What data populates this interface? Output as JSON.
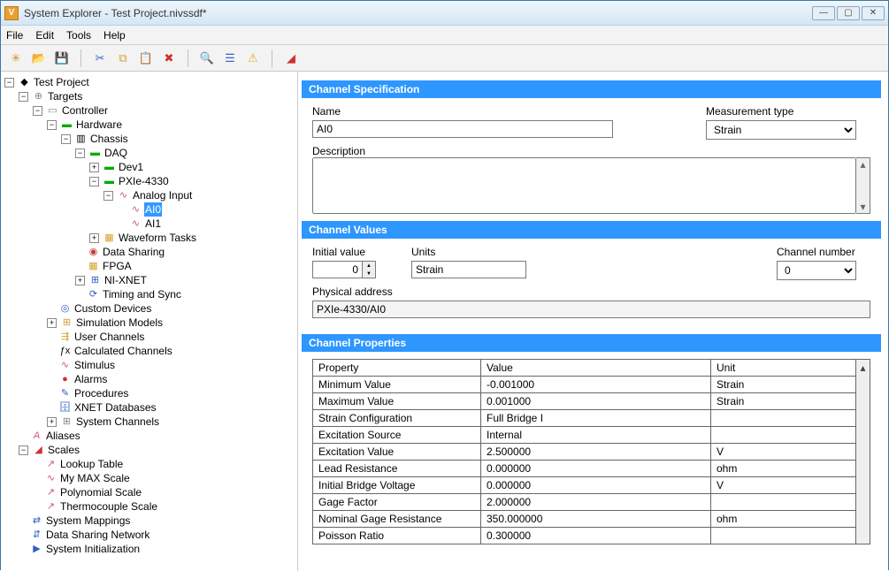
{
  "window": {
    "title": "System Explorer - Test Project.nivssdf*"
  },
  "menu": {
    "file": "File",
    "edit": "Edit",
    "tools": "Tools",
    "help": "Help"
  },
  "tree": {
    "root": "Test Project",
    "targets": "Targets",
    "controller": "Controller",
    "hardware": "Hardware",
    "chassis": "Chassis",
    "daq": "DAQ",
    "dev1": "Dev1",
    "pxie": "PXIe-4330",
    "ai": "Analog Input",
    "ai0": "AI0",
    "ai1": "AI1",
    "waveform": "Waveform Tasks",
    "datasharing": "Data Sharing",
    "fpga": "FPGA",
    "nixnet": "NI-XNET",
    "timing": "Timing and Sync",
    "custom": "Custom Devices",
    "sim": "Simulation Models",
    "userch": "User Channels",
    "calc": "Calculated Channels",
    "stimulus": "Stimulus",
    "alarms": "Alarms",
    "procedures": "Procedures",
    "xnetdb": "XNET Databases",
    "sysch": "System Channels",
    "aliases": "Aliases",
    "scales": "Scales",
    "lookup": "Lookup Table",
    "mymax": "My MAX Scale",
    "poly": "Polynomial Scale",
    "thermo": "Thermocouple Scale",
    "sysmap": "System Mappings",
    "dsn": "Data Sharing Network",
    "sysinit": "System Initialization"
  },
  "spec": {
    "header": "Channel Specification",
    "name_label": "Name",
    "name_value": "AI0",
    "meas_label": "Measurement type",
    "meas_value": "Strain",
    "desc_label": "Description",
    "desc_value": ""
  },
  "values": {
    "header": "Channel Values",
    "initial_label": "Initial value",
    "initial_value": "0",
    "units_label": "Units",
    "units_value": "Strain",
    "chnum_label": "Channel number",
    "chnum_value": "0",
    "phys_label": "Physical address",
    "phys_value": "PXIe-4330/AI0"
  },
  "props": {
    "header": "Channel Properties",
    "col_property": "Property",
    "col_value": "Value",
    "col_unit": "Unit",
    "rows": [
      {
        "p": "Minimum Value",
        "v": "-0.001000",
        "u": "Strain"
      },
      {
        "p": "Maximum Value",
        "v": "0.001000",
        "u": "Strain"
      },
      {
        "p": "Strain Configuration",
        "v": "Full Bridge I",
        "u": ""
      },
      {
        "p": "Excitation Source",
        "v": "Internal",
        "u": ""
      },
      {
        "p": "Excitation Value",
        "v": "2.500000",
        "u": "V"
      },
      {
        "p": "Lead Resistance",
        "v": "0.000000",
        "u": "ohm"
      },
      {
        "p": "Initial Bridge Voltage",
        "v": "0.000000",
        "u": "V"
      },
      {
        "p": "Gage Factor",
        "v": "2.000000",
        "u": ""
      },
      {
        "p": "Nominal Gage Resistance",
        "v": "350.000000",
        "u": "ohm"
      },
      {
        "p": "Poisson Ratio",
        "v": "0.300000",
        "u": ""
      }
    ]
  }
}
